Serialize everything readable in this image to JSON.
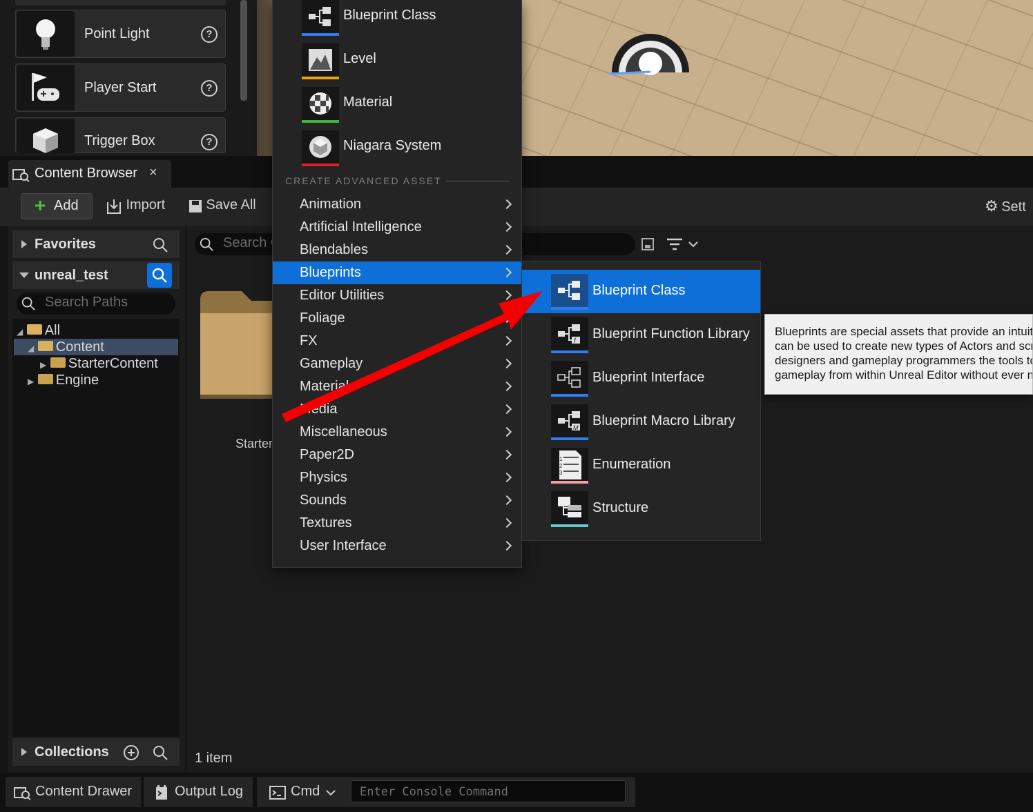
{
  "place_actors": {
    "items": [
      {
        "label": "Point Light",
        "icon": "lightbulb-icon"
      },
      {
        "label": "Player Start",
        "icon": "flag-gamepad-icon"
      },
      {
        "label": "Trigger Box",
        "icon": "cube-icon"
      }
    ]
  },
  "content_browser": {
    "tab_label": "Content Browser",
    "tab_close": "×",
    "toolbar": {
      "add_label": "Add",
      "import_label": "Import",
      "save_all_label": "Save All",
      "settings_label": "Sett"
    },
    "sidebar": {
      "favorites_label": "Favorites",
      "project_label": "unreal_test",
      "search_paths_placeholder": "Search Paths",
      "tree": [
        "All",
        "Content",
        "StarterContent",
        "Engine"
      ],
      "collections_label": "Collections"
    },
    "asset_search_placeholder": "Search C",
    "folder_label": "Starter",
    "item_count": "1 item"
  },
  "add_menu": {
    "basic_assets": [
      {
        "label": "Blueprint Class",
        "bar_color": "#2f7bf0"
      },
      {
        "label": "Level",
        "bar_color": "#f0a010"
      },
      {
        "label": "Material",
        "bar_color": "#38b838"
      },
      {
        "label": "Niagara System",
        "bar_color": "#e02020"
      }
    ],
    "advanced_header": "CREATE ADVANCED ASSET",
    "categories": [
      "Animation",
      "Artificial Intelligence",
      "Blendables",
      "Blueprints",
      "Editor Utilities",
      "Foliage",
      "FX",
      "Gameplay",
      "Materials",
      "Media",
      "Miscellaneous",
      "Paper2D",
      "Physics",
      "Sounds",
      "Textures",
      "User Interface"
    ],
    "active_category": "Blueprints"
  },
  "blueprints_submenu": {
    "items": [
      {
        "label": "Blueprint Class",
        "bar_color": "#2f7bf0"
      },
      {
        "label": "Blueprint Function Library",
        "bar_color": "#2f7bf0"
      },
      {
        "label": "Blueprint Interface",
        "bar_color": "#2f7bf0"
      },
      {
        "label": "Blueprint Macro Library",
        "bar_color": "#2f7bf0"
      },
      {
        "label": "Enumeration",
        "bar_color": "#f0a0a0"
      },
      {
        "label": "Structure",
        "bar_color": "#60c8d0"
      }
    ]
  },
  "tooltip": {
    "text": "Blueprints are special assets that provide an intuitive, node-based interface that can be used to create new types of Actors and script level events; giving designers and gameplay programmers the tools to quickly create and iterate gameplay from within Unreal Editor without ever needing to write a line of code."
  },
  "status_bar": {
    "content_drawer_label": "Content Drawer",
    "output_log_label": "Output Log",
    "cmd_label": "Cmd",
    "console_placeholder": "Enter Console Command"
  },
  "colors": {
    "accent": "#0f6fd8",
    "add_plus": "#4fc23d",
    "annotation_arrow": "#f40000"
  }
}
